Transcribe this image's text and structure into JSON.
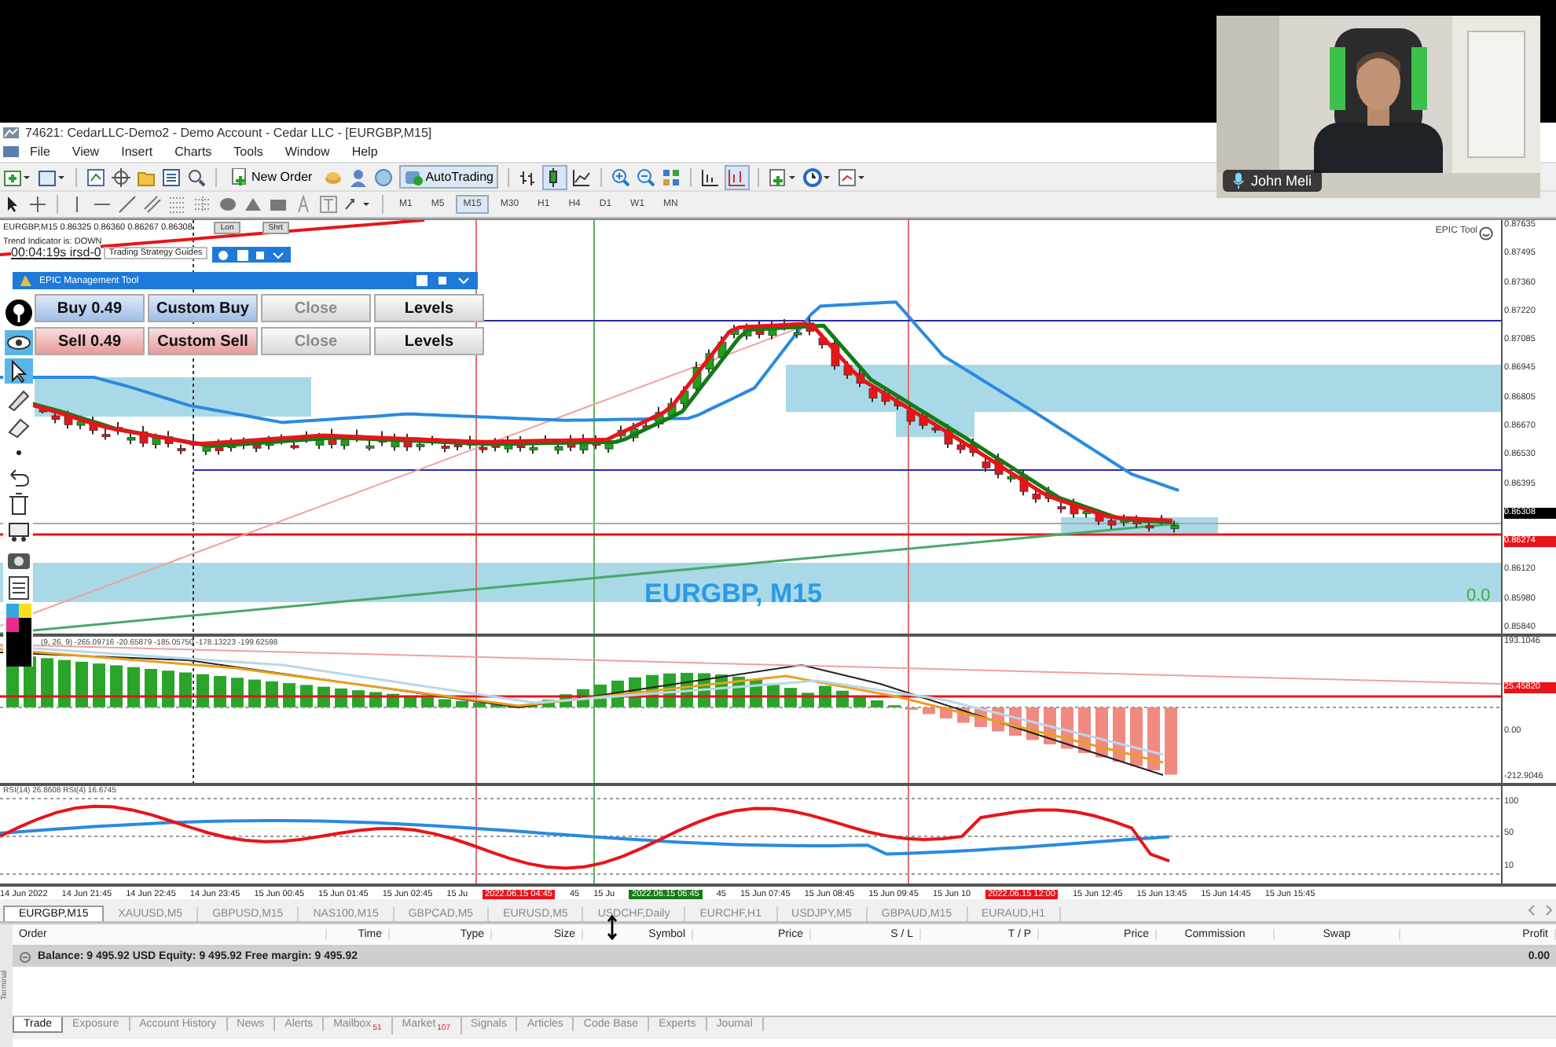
{
  "webcam": {
    "kind": "picture",
    "name_tag": "John Meli"
  },
  "window": {
    "title": "74621: CedarLLC-Demo2 - Demo Account - Cedar LLC - [EURGBP,M15]"
  },
  "menu": [
    "File",
    "View",
    "Insert",
    "Charts",
    "Tools",
    "Window",
    "Help"
  ],
  "toolbar": {
    "new_order": "New Order",
    "autotrading": "AutoTrading"
  },
  "timeframes": [
    {
      "label": "M1",
      "selected": false
    },
    {
      "label": "M5",
      "selected": false
    },
    {
      "label": "M15",
      "selected": true
    },
    {
      "label": "M30",
      "selected": false
    },
    {
      "label": "H1",
      "selected": false
    },
    {
      "label": "H4",
      "selected": false
    },
    {
      "label": "D1",
      "selected": false
    },
    {
      "label": "W1",
      "selected": false
    },
    {
      "label": "MN",
      "selected": false
    }
  ],
  "chart": {
    "info": "EURGBP,M15  0.86325 0.86360 0.86267 0.86308",
    "trend": "Trend Indicator is: DOWN",
    "long_button": "Lon",
    "short_button": "Shrt",
    "timer": "00:04:19s irsd-0",
    "guide_panel": "Trading Strategy Guides",
    "epic_tool": "EPIC Tool",
    "symbol_label": "EURGBP, M15",
    "value_label": "0.0",
    "indicator_legend": "(9, 26, 9) -265.09716 -20.65879 -185.05750 -178.13223 -199.62598",
    "rsi_legend": "RSI(14) 26.8608  RSI(4) 16.6745"
  },
  "price_axis": [
    {
      "label": "0.87635",
      "kind": "tick"
    },
    {
      "label": "0.87495",
      "kind": "tick"
    },
    {
      "label": "0.87360",
      "kind": "tick"
    },
    {
      "label": "0.87220",
      "kind": "tick"
    },
    {
      "label": "0.87085",
      "kind": "tick"
    },
    {
      "label": "0.86945",
      "kind": "tick"
    },
    {
      "label": "0.86805",
      "kind": "tick"
    },
    {
      "label": "0.86670",
      "kind": "tick"
    },
    {
      "label": "0.86530",
      "kind": "tick"
    },
    {
      "label": "0.86395",
      "kind": "tick"
    },
    {
      "label": "0.86308",
      "kind": "bid"
    },
    {
      "label": "0.86274",
      "kind": "ask"
    },
    {
      "label": "0.86120",
      "kind": "tick"
    },
    {
      "label": "0.85980",
      "kind": "tick"
    },
    {
      "label": "0.85840",
      "kind": "tick"
    }
  ],
  "indicator_axis": [
    {
      "label": "193.1046",
      "kind": "tick"
    },
    {
      "label": "25.45820",
      "kind": "ask"
    },
    {
      "label": "0.00",
      "kind": "tick"
    },
    {
      "label": "-212.9046",
      "kind": "tick"
    }
  ],
  "rsi_axis": [
    "100",
    "50",
    "10"
  ],
  "time_axis": [
    {
      "label": "14 Jun 2022",
      "kind": "time"
    },
    {
      "label": "14 Jun 21:45",
      "kind": "time"
    },
    {
      "label": "14 Jun 22:45",
      "kind": "time"
    },
    {
      "label": "14 Jun 23:45",
      "kind": "time"
    },
    {
      "label": "15 Jun 00:45",
      "kind": "time"
    },
    {
      "label": "15 Jun 01:45",
      "kind": "time"
    },
    {
      "label": "15 Jun 02:45",
      "kind": "time"
    },
    {
      "label": "15 Ju",
      "kind": "time"
    },
    {
      "label": "2022.06.15 04:45",
      "kind": "marker",
      "color": "#e8141a"
    },
    {
      "label": "45",
      "kind": "time"
    },
    {
      "label": "15 Ju",
      "kind": "time"
    },
    {
      "label": "2022.06.15 06:45",
      "kind": "marker",
      "color": "#177a17"
    },
    {
      "label": "45",
      "kind": "time"
    },
    {
      "label": "15 Jun 07:45",
      "kind": "time"
    },
    {
      "label": "15 Jun 08:45",
      "kind": "time"
    },
    {
      "label": "15 Jun 09:45",
      "kind": "time"
    },
    {
      "label": "15 Jun 10",
      "kind": "time"
    },
    {
      "label": "2022.06.15 12:00",
      "kind": "marker",
      "color": "#e8141a"
    },
    {
      "label": "15 Jun 12:45",
      "kind": "time"
    },
    {
      "label": "15 Jun 13:45",
      "kind": "time"
    },
    {
      "label": "15 Jun 14:45",
      "kind": "time"
    },
    {
      "label": "15 Jun 15:45",
      "kind": "time"
    }
  ],
  "epic_panel": {
    "title": "EPIC Management Tool",
    "buttons": [
      {
        "label": "Buy 0.49",
        "kind": "buy",
        "disabled": false
      },
      {
        "label": "Custom Buy",
        "kind": "buy",
        "disabled": false
      },
      {
        "label": "Close",
        "kind": "plain",
        "disabled": true
      },
      {
        "label": "Levels",
        "kind": "plain",
        "disabled": false
      },
      {
        "label": "Sell 0.49",
        "kind": "sell",
        "disabled": false
      },
      {
        "label": "Custom Sell",
        "kind": "sell",
        "disabled": false
      },
      {
        "label": "Close",
        "kind": "plain",
        "disabled": true
      },
      {
        "label": "Levels",
        "kind": "plain",
        "disabled": false
      }
    ]
  },
  "symbol_tabs": [
    {
      "label": "EURGBP,M15",
      "selected": true
    },
    {
      "label": "XAUUSD,M5",
      "selected": false
    },
    {
      "label": "GBPUSD,M15",
      "selected": false
    },
    {
      "label": "NAS100,M15",
      "selected": false
    },
    {
      "label": "GBPCAD,M5",
      "selected": false
    },
    {
      "label": "EURUSD,M5",
      "selected": false
    },
    {
      "label": "USDCHF,Daily",
      "selected": false
    },
    {
      "label": "EURCHF,H1",
      "selected": false
    },
    {
      "label": "USDJPY,M5",
      "selected": false
    },
    {
      "label": "GBPAUD,M15",
      "selected": false
    },
    {
      "label": "EURAUD,H1",
      "selected": false
    }
  ],
  "terminal": {
    "side_label": "Terminal",
    "columns": [
      "Order",
      "Time",
      "Type",
      "Size",
      "Symbol",
      "Price",
      "S / L",
      "T / P",
      "Price",
      "Commission",
      "Swap",
      "Profit"
    ],
    "balance": "Balance: 9 495.92 USD  Equity: 9 495.92  Free margin: 9 495.92",
    "profit": "0.00",
    "tabs": [
      {
        "label": "Trade",
        "selected": true
      },
      {
        "label": "Exposure",
        "selected": false
      },
      {
        "label": "Account History",
        "selected": false
      },
      {
        "label": "News",
        "selected": false
      },
      {
        "label": "Alerts",
        "selected": false
      },
      {
        "label": "Mailbox",
        "badge": "51",
        "selected": false
      },
      {
        "label": "Market",
        "badge": "107",
        "selected": false
      },
      {
        "label": "Signals",
        "selected": false
      },
      {
        "label": "Articles",
        "selected": false
      },
      {
        "label": "Code Base",
        "selected": false
      },
      {
        "label": "Experts",
        "selected": false
      },
      {
        "label": "Journal",
        "selected": false
      }
    ]
  }
}
